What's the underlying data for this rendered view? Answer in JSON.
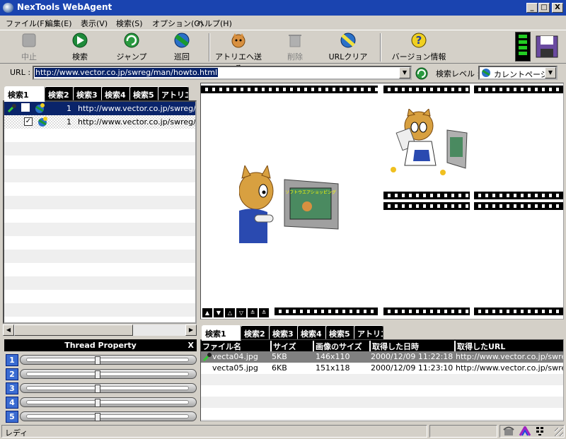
{
  "window": {
    "title": "NexTools WebAgent",
    "btn_min": "_",
    "btn_max": "□",
    "btn_close": "X"
  },
  "menus": [
    "ファイル(F)",
    "編集(E)",
    "表示(V)",
    "検索(S)",
    "オプション(O)",
    "ヘルプ(H)"
  ],
  "toolbar": {
    "stop": "中止",
    "search": "検索",
    "jump": "ジャンプ",
    "patrol": "巡回",
    "send_to_atelier": "アトリエへ送る",
    "delete": "削除",
    "url_clear": "URLクリア",
    "version": "バージョン情報"
  },
  "urlbar": {
    "label": "URL :",
    "value": "http://www.vector.co.jp/swreg/man/howto.html",
    "level_label": "検索レベル :",
    "level_value": "カレントページ"
  },
  "left_tabs": [
    "検索1",
    "検索2",
    "検索3",
    "検索4",
    "検索5",
    "アトリエ"
  ],
  "search_rows": [
    {
      "count": "1",
      "url": "http://www.vector.co.jp/swreg/m"
    },
    {
      "count": "1",
      "url": "http://www.vector.co.jp/swreg/m"
    }
  ],
  "thread_property": {
    "title": "Thread Property",
    "close": "X",
    "threads": [
      "1",
      "2",
      "3",
      "4",
      "5"
    ]
  },
  "bottom_tabs": [
    "検索1",
    "検索2",
    "検索3",
    "検索4",
    "検索5",
    "アトリエ"
  ],
  "file_table": {
    "headers": [
      "ファイル名",
      "サイズ",
      "画像のサイズ",
      "取得した日時",
      "取得したURL"
    ],
    "rows": [
      {
        "name": "vecta04.jpg",
        "size": "5KB",
        "dims": "146x110",
        "date": "2000/12/09 11:22:18",
        "url": "http://www.vector.co.jp/swre"
      },
      {
        "name": "vecta05.jpg",
        "size": "6KB",
        "dims": "151x118",
        "date": "2000/12/09 11:23:10",
        "url": "http://www.vector.co.jp/swre"
      }
    ]
  },
  "preview": {
    "monitor_text": "ソフトウエアショッピング",
    "nav_buttons": [
      "▲",
      "▼",
      "△",
      "▽",
      "≙",
      "≚"
    ]
  },
  "status": {
    "text": "レディ"
  },
  "colors": {
    "title_bar": "#1a44b0",
    "selection": "#0a246a"
  }
}
